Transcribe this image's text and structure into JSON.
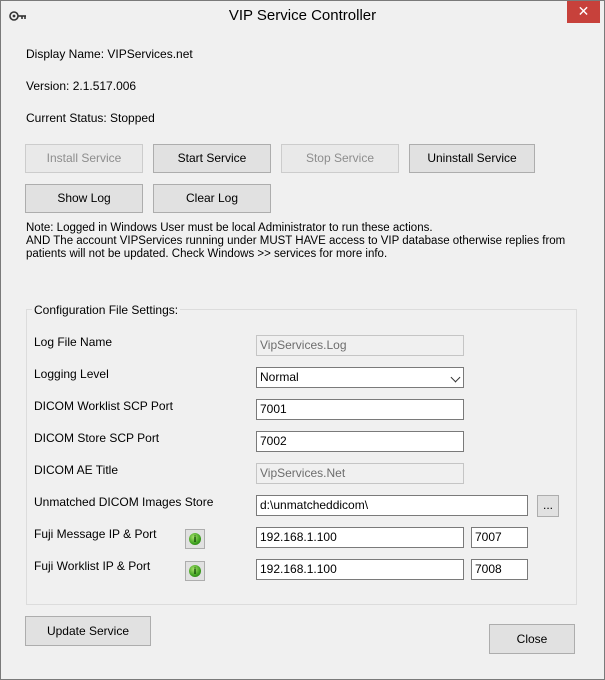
{
  "window": {
    "title": "VIP Service Controller",
    "close_label": "✕"
  },
  "info": {
    "display_name": "Display Name: VIPServices.net",
    "version": "Version: 2.1.517.006",
    "status": "Current Status: Stopped"
  },
  "buttons": {
    "install": "Install Service",
    "start": "Start Service",
    "stop": "Stop Service",
    "uninstall": "Uninstall Service",
    "show_log": "Show Log",
    "clear_log": "Clear Log",
    "update": "Update Service",
    "close": "Close",
    "browse": "..."
  },
  "note": {
    "line1": "Note: Logged in Windows User must be local Administrator to run these actions.",
    "line2": "AND The account VIPServices running under MUST HAVE access to VIP database otherwise replies from patients will not be updated. Check Windows >> services for more info."
  },
  "config": {
    "group_title": "Configuration File Settings:",
    "log_file_label": "Log File Name",
    "log_file_value": "VipServices.Log",
    "logging_level_label": "Logging Level",
    "logging_level_value": "Normal",
    "worklist_port_label": "DICOM Worklist SCP Port",
    "worklist_port_value": "7001",
    "store_port_label": "DICOM Store SCP Port",
    "store_port_value": "7002",
    "ae_title_label": "DICOM AE Title",
    "ae_title_value": "VipServices.Net",
    "unmatched_label": "Unmatched DICOM Images Store",
    "unmatched_value": "d:\\unmatcheddicom\\",
    "fuji_msg_label": "Fuji Message IP & Port",
    "fuji_msg_ip": "192.168.1.100",
    "fuji_msg_port": "7007",
    "fuji_wl_label": "Fuji Worklist IP & Port",
    "fuji_wl_ip": "192.168.1.100",
    "fuji_wl_port": "7008"
  },
  "icons": {
    "app": "key-icon",
    "ping": "ping-status-icon"
  },
  "colors": {
    "close_button": "#c7413b",
    "ping_green": "#3ea01f"
  }
}
